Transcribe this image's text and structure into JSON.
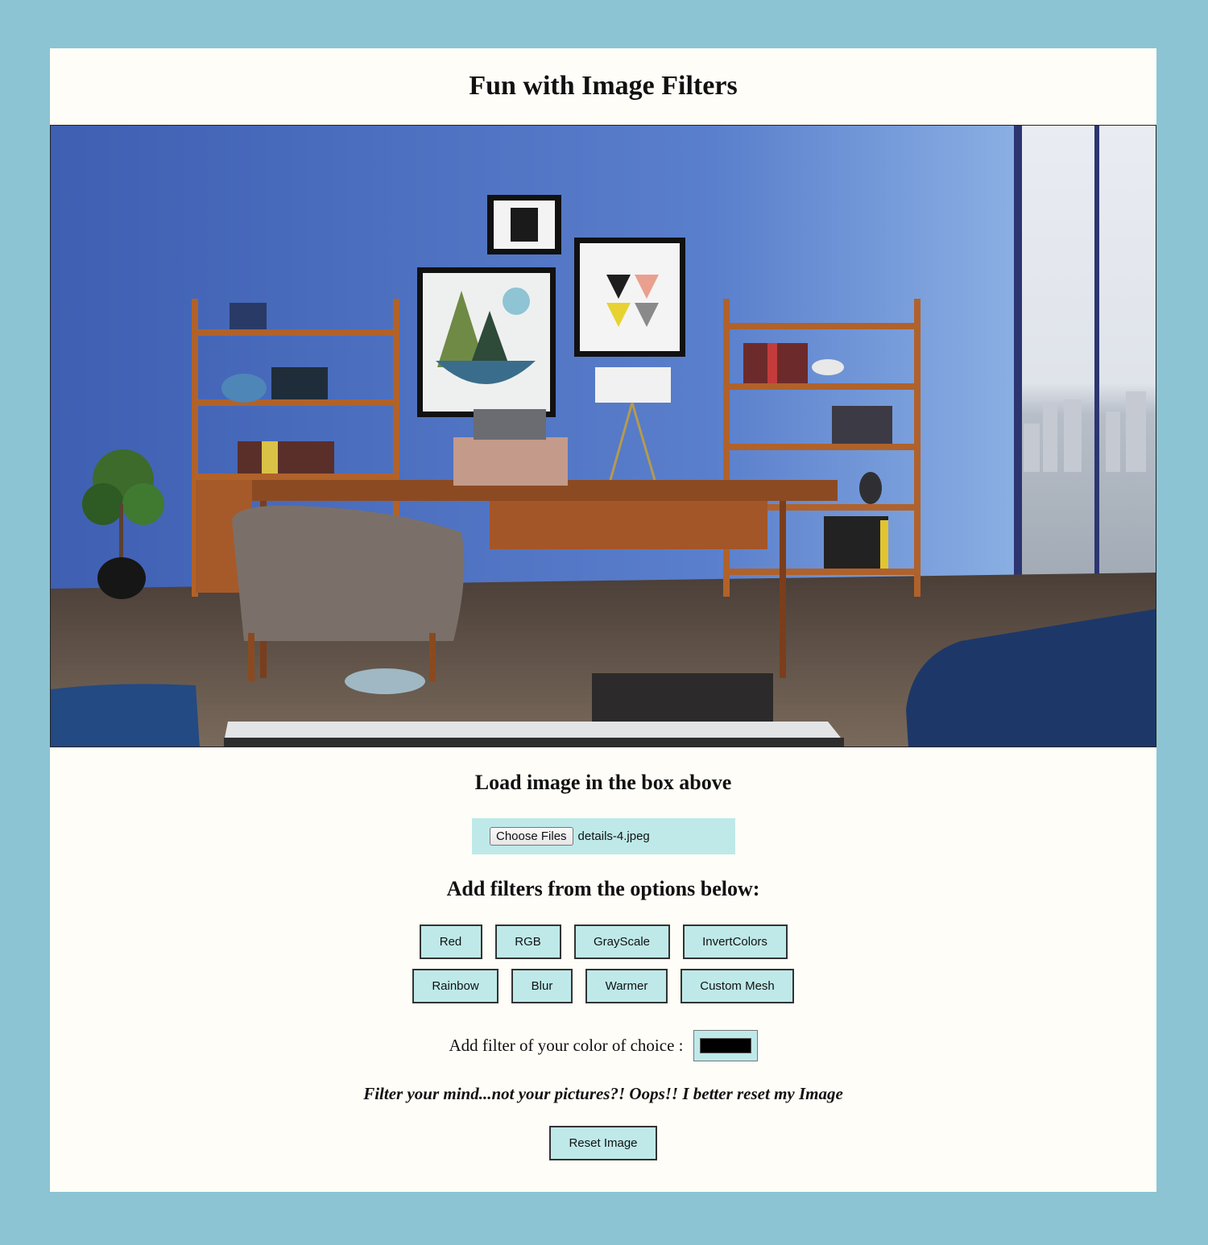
{
  "page": {
    "title": "Fun with Image Filters"
  },
  "canvas": {
    "description_icon": "photo-canvas"
  },
  "loader": {
    "heading": "Load image in the box above",
    "choose_label": "Choose Files",
    "file_name": "details-4.jpeg"
  },
  "filters": {
    "heading": "Add filters from the options below:",
    "row1": [
      "Red",
      "RGB",
      "GrayScale",
      "InvertColors"
    ],
    "row2": [
      "Rainbow",
      "Blur",
      "Warmer",
      "Custom Mesh"
    ]
  },
  "color_filter": {
    "label": "Add filter of your color of choice :",
    "value": "#000000"
  },
  "tagline": "Filter your mind...not your pictures?! Oops!! I better reset my Image",
  "reset": {
    "label": "Reset Image"
  },
  "colors": {
    "background": "#8cc4d3",
    "card": "#fefdf8",
    "button": "#bfe9e9"
  }
}
